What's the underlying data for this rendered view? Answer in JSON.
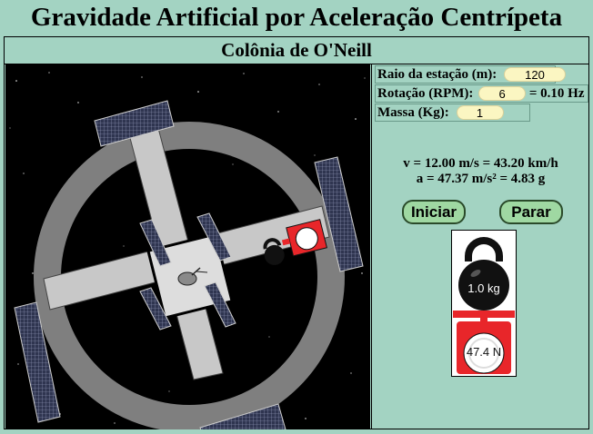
{
  "app": {
    "title": "Gravidade Artificial por Aceleração Centrípeta"
  },
  "scene": {
    "subtitle": "Colônia de O'Neill"
  },
  "controls": {
    "radius": {
      "label": "Raio da estação (m):",
      "value": "120"
    },
    "rotation": {
      "label": "Rotação (RPM):",
      "value": "6",
      "suffix": "= 0.10 Hz"
    },
    "mass": {
      "label": "Massa (Kg):",
      "value": "1"
    }
  },
  "results": {
    "velocity": "v = 12.00 m/s = 43.20 km/h",
    "acceleration": "a = 47.37 m/s² = 4.83 g"
  },
  "buttons": {
    "start": "Iniciar",
    "stop": "Parar"
  },
  "readout": {
    "kettlebell": "1.0 kg",
    "scale": "47.4 N"
  },
  "colors": {
    "background": "#a3d3c2",
    "input_bg": "#fbf6c2",
    "button_bg": "#9fd8a2",
    "scale_red": "#e8262a"
  },
  "icons": [
    "kettlebell-icon",
    "scale-icon",
    "solar-panel-icon",
    "satellite-dish-icon"
  ]
}
